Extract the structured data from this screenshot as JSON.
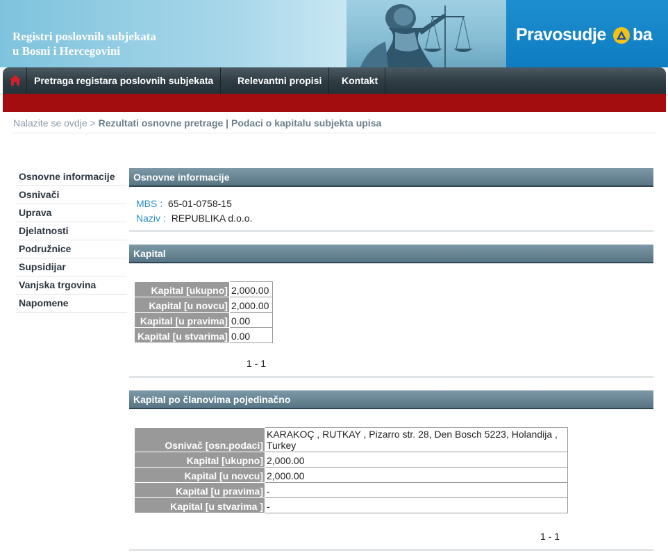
{
  "header": {
    "title_line1": "Registri poslovnih subjekata",
    "title_line2": "u Bosni i Hercegovini",
    "logo_text": "Pravosudje",
    "logo_suffix": "ba"
  },
  "nav": {
    "items": [
      {
        "label": "Pretraga registara poslovnih subjekata"
      },
      {
        "label": "Relevantni propisi"
      },
      {
        "label": "Kontakt"
      }
    ]
  },
  "breadcrumb": {
    "prefix": "Nalazite se ovdje >",
    "path": "Rezultati osnovne pretrage | Podaci o kapitalu subjekta upisa"
  },
  "sidebar": {
    "items": [
      {
        "label": "Osnovne informacije"
      },
      {
        "label": "Osnivači"
      },
      {
        "label": "Uprava"
      },
      {
        "label": "Djelatnosti"
      },
      {
        "label": "Podružnice"
      },
      {
        "label": "Supsidijar"
      },
      {
        "label": "Vanjska trgovina"
      },
      {
        "label": "Napomene"
      }
    ]
  },
  "osnovne": {
    "title": "Osnovne informacije",
    "mbs_label": "MBS :",
    "mbs_value": "65-01-0758-15",
    "naziv_label": "Naziv :",
    "naziv_value": "REPUBLIKA d.o.o."
  },
  "kapital": {
    "title": "Kapital",
    "rows": [
      {
        "label": "Kapital [ukupno]",
        "value": "2,000.00"
      },
      {
        "label": "Kapital [u novcu]",
        "value": "2,000.00"
      },
      {
        "label": "Kapital [u pravima]",
        "value": "0.00"
      },
      {
        "label": "Kapital [u stvarima]",
        "value": "0.00"
      }
    ],
    "pager": "1 - 1"
  },
  "clanovi": {
    "title": "Kapital po članovima pojedinačno",
    "rows": [
      {
        "label": "Osnivač [osn.podaci]",
        "value": "KARAKOÇ , RUTKAY , Pizarro str. 28, Den Bosch 5223, Holandija , Turkey"
      },
      {
        "label": "Kapital [ukupno]",
        "value": "2,000.00"
      },
      {
        "label": "Kapital [u novcu]",
        "value": "2,000.00"
      },
      {
        "label": "Kapital [u pravima]",
        "value": "-"
      },
      {
        "label": "Kapital [u stvarima ]",
        "value": "-"
      }
    ],
    "pager": "1 - 1"
  },
  "colors": {
    "nav_bg": "#2e3b42",
    "red_bar": "#a30d10",
    "section_header": "#587585",
    "label_cell": "#999999",
    "link_blue": "#2a8fc4",
    "logo_blue": "#0f7cc1"
  }
}
